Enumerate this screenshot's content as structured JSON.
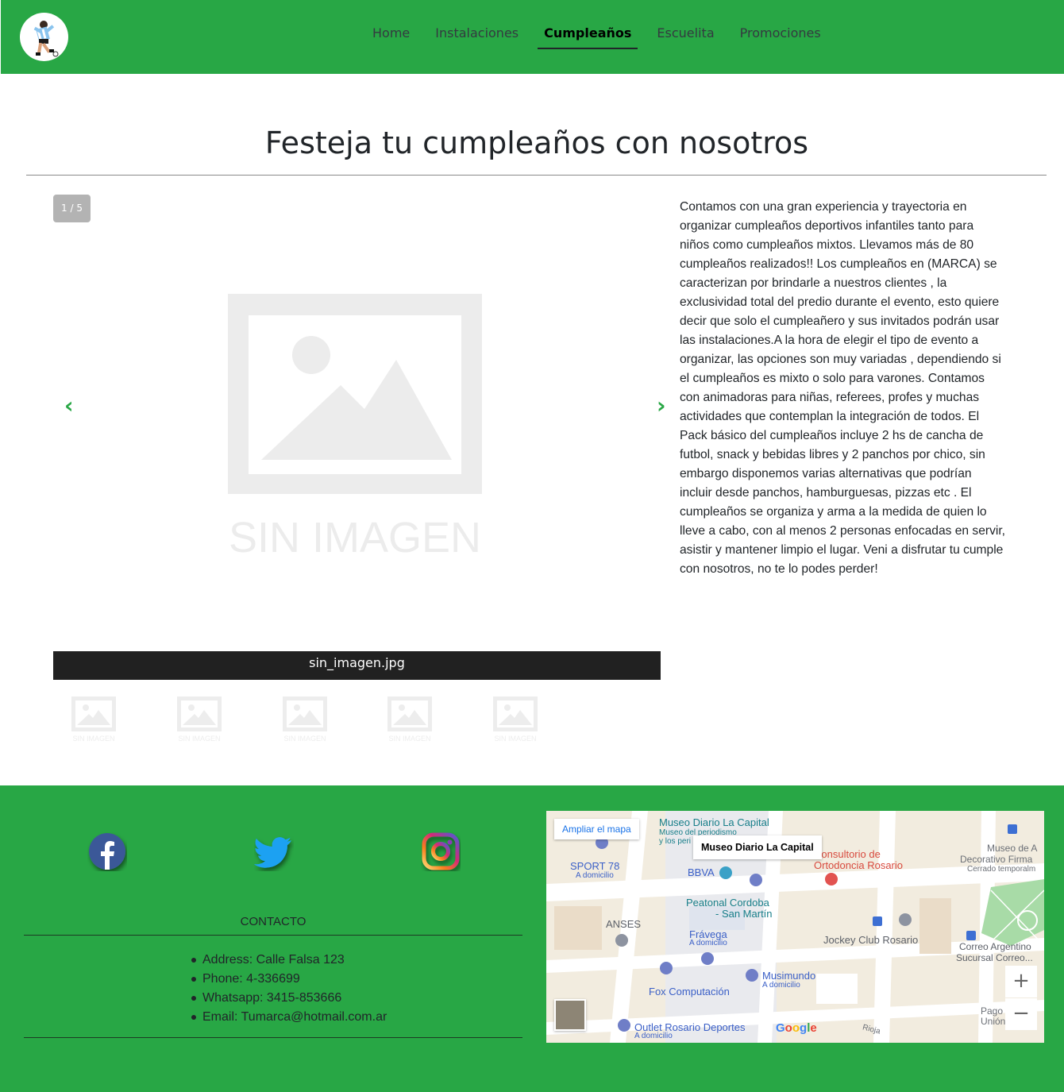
{
  "nav": {
    "items": [
      {
        "label": "Home",
        "active": false
      },
      {
        "label": "Instalaciones",
        "active": false
      },
      {
        "label": "Cumpleaños",
        "active": true
      },
      {
        "label": "Escuelita",
        "active": false
      },
      {
        "label": "Promociones",
        "active": false
      }
    ],
    "accent_color": "#28a745"
  },
  "page": {
    "title": "Festeja tu cumpleaños con nosotros"
  },
  "carousel": {
    "counter": "1 / 5",
    "prev_icon": "chevron-left-icon",
    "next_icon": "chevron-right-icon",
    "arrow_prev": "‹",
    "arrow_next": "›",
    "placeholder_text": "SIN IMAGEN",
    "caption": "sin_imagen.jpg",
    "thumb_text": "SIN IMAGEN"
  },
  "description": "Contamos con una gran experiencia y trayectoria en organizar cumpleaños deportivos infantiles tanto para niños como cumpleaños mixtos. Llevamos más de 80 cumpleaños realizados!! Los cumpleaños en (MARCA) se caracterizan por brindarle a nuestros clientes , la exclusividad total del predio durante el evento, esto quiere decir que solo el cumpleañero y sus invitados podrán usar las instalaciones.A la hora de elegir el tipo de evento a organizar, las opciones son muy variadas , dependiendo si el cumpleaños es mixto o solo para varones. Contamos con animadoras para niñas, referees, profes y muchas actividades que contemplan la integración de todos. El Pack básico del cumpleaños incluye 2 hs de cancha de futbol, snack y bebidas libres y 2 panchos por chico, sin embargo disponemos varias alternativas que podrían incluir desde panchos, hamburguesas, pizzas etc . El cumpleaños se organiza y arma a la medida de quien lo lleve a cabo, con al menos 2 personas enfocadas en servir, asistir y mantener limpio el lugar. Veni a disfrutar tu cumple con nosotros, no te lo podes perder!",
  "footer": {
    "social": [
      "facebook-icon",
      "twitter-icon",
      "instagram-icon"
    ],
    "contact_title": "CONTACTO",
    "contact_items": [
      "Address: Calle Falsa 123",
      "Phone: 4-336699",
      "Whatsapp: 3415-853666",
      "Email: Tumarca@hotmail.com.ar"
    ]
  },
  "map": {
    "expand_label": "Ampliar el mapa",
    "info_title": "Museo Diario La Capital",
    "zoom_in": "+",
    "zoom_out": "−",
    "google": "Google",
    "labels": {
      "museo_diario": "Museo Diario La Capital",
      "museo_sub": "Museo del periodismo",
      "museo_sub2": "y los peri",
      "sport": "SPORT 78",
      "sport_sub": "A domicilio",
      "bbva": "BBVA",
      "consultorio": "Consultorio de",
      "consultorio2": "Ortodoncia Rosario",
      "museo_deco": "Museo de A",
      "museo_deco2": "Decorativo Firma",
      "museo_deco3": "Cerrado temporalm",
      "peatonal": "Peatonal Cordoba",
      "peatonal2": "- San Martín",
      "anses": "ANSES",
      "fravega": "Frávega",
      "fravega_sub": "A domicilio",
      "jockey": "Jockey Club Rosario",
      "correo": "Correo Argentino",
      "correo2": "Sucursal Correo...",
      "musimundo": "Musimundo",
      "musimundo_sub": "A domicilio",
      "fox": "Fox Computación",
      "outlet": "Outlet Rosario Deportes",
      "outlet_sub": "A domicilio",
      "rioja": "Rioja",
      "pago": "Pago",
      "union": "Unión"
    }
  }
}
